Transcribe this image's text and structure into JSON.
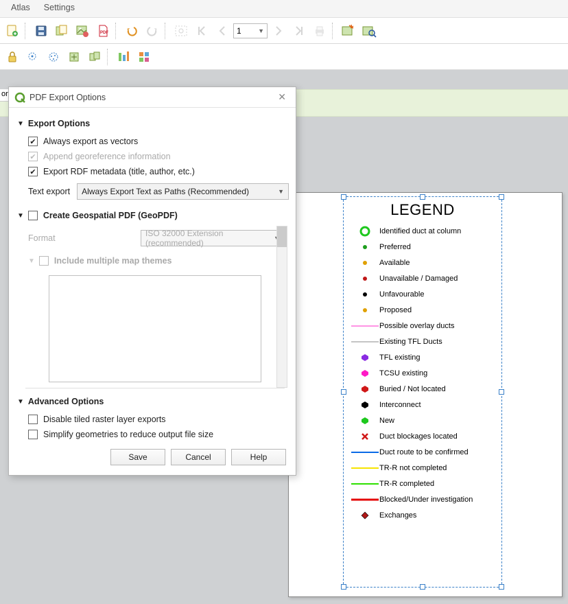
{
  "menu": {
    "atlas": "Atlas",
    "settings": "Settings"
  },
  "dialog": {
    "title": "PDF Export Options",
    "export_section": "Export Options",
    "vectors": "Always export as vectors",
    "georef": "Append georeference information",
    "rdf": "Export RDF metadata (title, author, etc.)",
    "text_export_label": "Text export",
    "text_export_value": "Always Export Text as Paths (Recommended)",
    "geo_section": "Create Geospatial PDF (GeoPDF)",
    "format_label": "Format",
    "format_value": "ISO 32000 Extension (recommended)",
    "themes": "Include multiple map themes",
    "adv_section": "Advanced Options",
    "disable_tiled": "Disable tiled raster layer exports",
    "simplify": "Simplify geometries to reduce output file size",
    "save": "Save",
    "cancel": "Cancel",
    "help": "Help"
  },
  "page_field": "1",
  "ort": "ort",
  "legend": {
    "title": "LEGEND",
    "items": [
      {
        "sym": "ring-green",
        "label": "Identified duct at column"
      },
      {
        "sym": "dot",
        "color": "#1e9e1e",
        "label": "Preferred"
      },
      {
        "sym": "dot",
        "color": "#e0a000",
        "label": "Available"
      },
      {
        "sym": "dot",
        "color": "#c01818",
        "label": "Unavailable / Damaged"
      },
      {
        "sym": "dot",
        "color": "#000",
        "label": "Unfavourable"
      },
      {
        "sym": "dot",
        "color": "#e0a000",
        "label": "Proposed"
      },
      {
        "sym": "line",
        "color": "#ff2ac8",
        "label": "Possible overlay ducts"
      },
      {
        "sym": "line",
        "color": "#888",
        "label": "Existing TFL Ducts"
      },
      {
        "sym": "hex",
        "color": "#8a2be2",
        "label": "TFL existing"
      },
      {
        "sym": "hex",
        "color": "#ff1ac6",
        "label": "TCSU existing"
      },
      {
        "sym": "hex",
        "color": "#d01818",
        "label": "Buried / Not located"
      },
      {
        "sym": "hex",
        "color": "#000",
        "label": "Interconnect"
      },
      {
        "sym": "hex",
        "color": "#1ec81e",
        "label": "New"
      },
      {
        "sym": "cross",
        "color": "#d01818",
        "label": "Duct blockages located"
      },
      {
        "sym": "line",
        "color": "#0a6ae6",
        "thick": "2",
        "label": "Duct route to be confirmed"
      },
      {
        "sym": "line",
        "color": "#f7e400",
        "thick": "2",
        "label": "TR-R not completed"
      },
      {
        "sym": "line",
        "color": "#2ee000",
        "thick": "2",
        "label": "TR-R completed"
      },
      {
        "sym": "line",
        "color": "#e40808",
        "thick": "3",
        "label": "Blocked/Under investigation"
      },
      {
        "sym": "diamond",
        "label": "Exchanges"
      }
    ]
  }
}
